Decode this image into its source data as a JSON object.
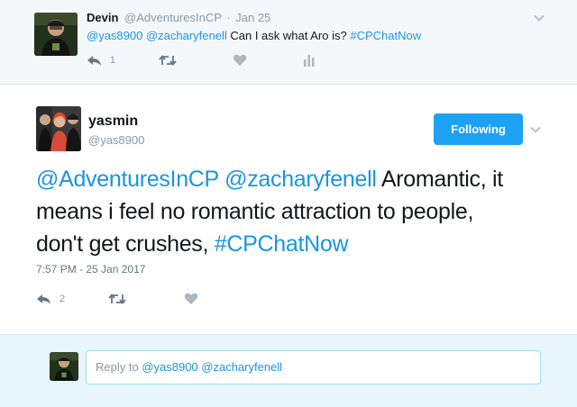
{
  "parent_tweet": {
    "author_name": "Devin",
    "author_handle": "@AdventuresInCP",
    "separator": "·",
    "date": "Jan 25",
    "mentions": "@yas8900 @zacharyfenell",
    "text": " Can I ask what Aro is? ",
    "hashtag": "#CPChatNow",
    "reply_count": "1"
  },
  "main_tweet": {
    "author_name": "yasmin",
    "author_handle": "@yas8900",
    "follow_label": "Following",
    "lines": [
      {
        "link": "@AdventuresInCP @zacharyfenell",
        "text": " Aromantic, it"
      },
      {
        "link": "",
        "text": "means i feel no romantic attraction to people,"
      },
      {
        "link": "#CPChatNow",
        "text": "don't get crushes, "
      }
    ],
    "timestamp": "7:57 PM - 25 Jan 2017",
    "reply_count": "2"
  },
  "reply_box": {
    "prefix": "Reply to ",
    "mentions": "@yas8900 @zacharyfenell"
  },
  "colors": {
    "link": "#1b95e0",
    "follow_button": "#1da1f2",
    "muted": "#8899a6",
    "parent_bg": "#f5f8fa",
    "reply_bar_bg": "#e8f5fd"
  },
  "icons": [
    "reply-icon",
    "retweet-icon",
    "like-icon",
    "analytics-icon",
    "chevron-down-icon"
  ]
}
